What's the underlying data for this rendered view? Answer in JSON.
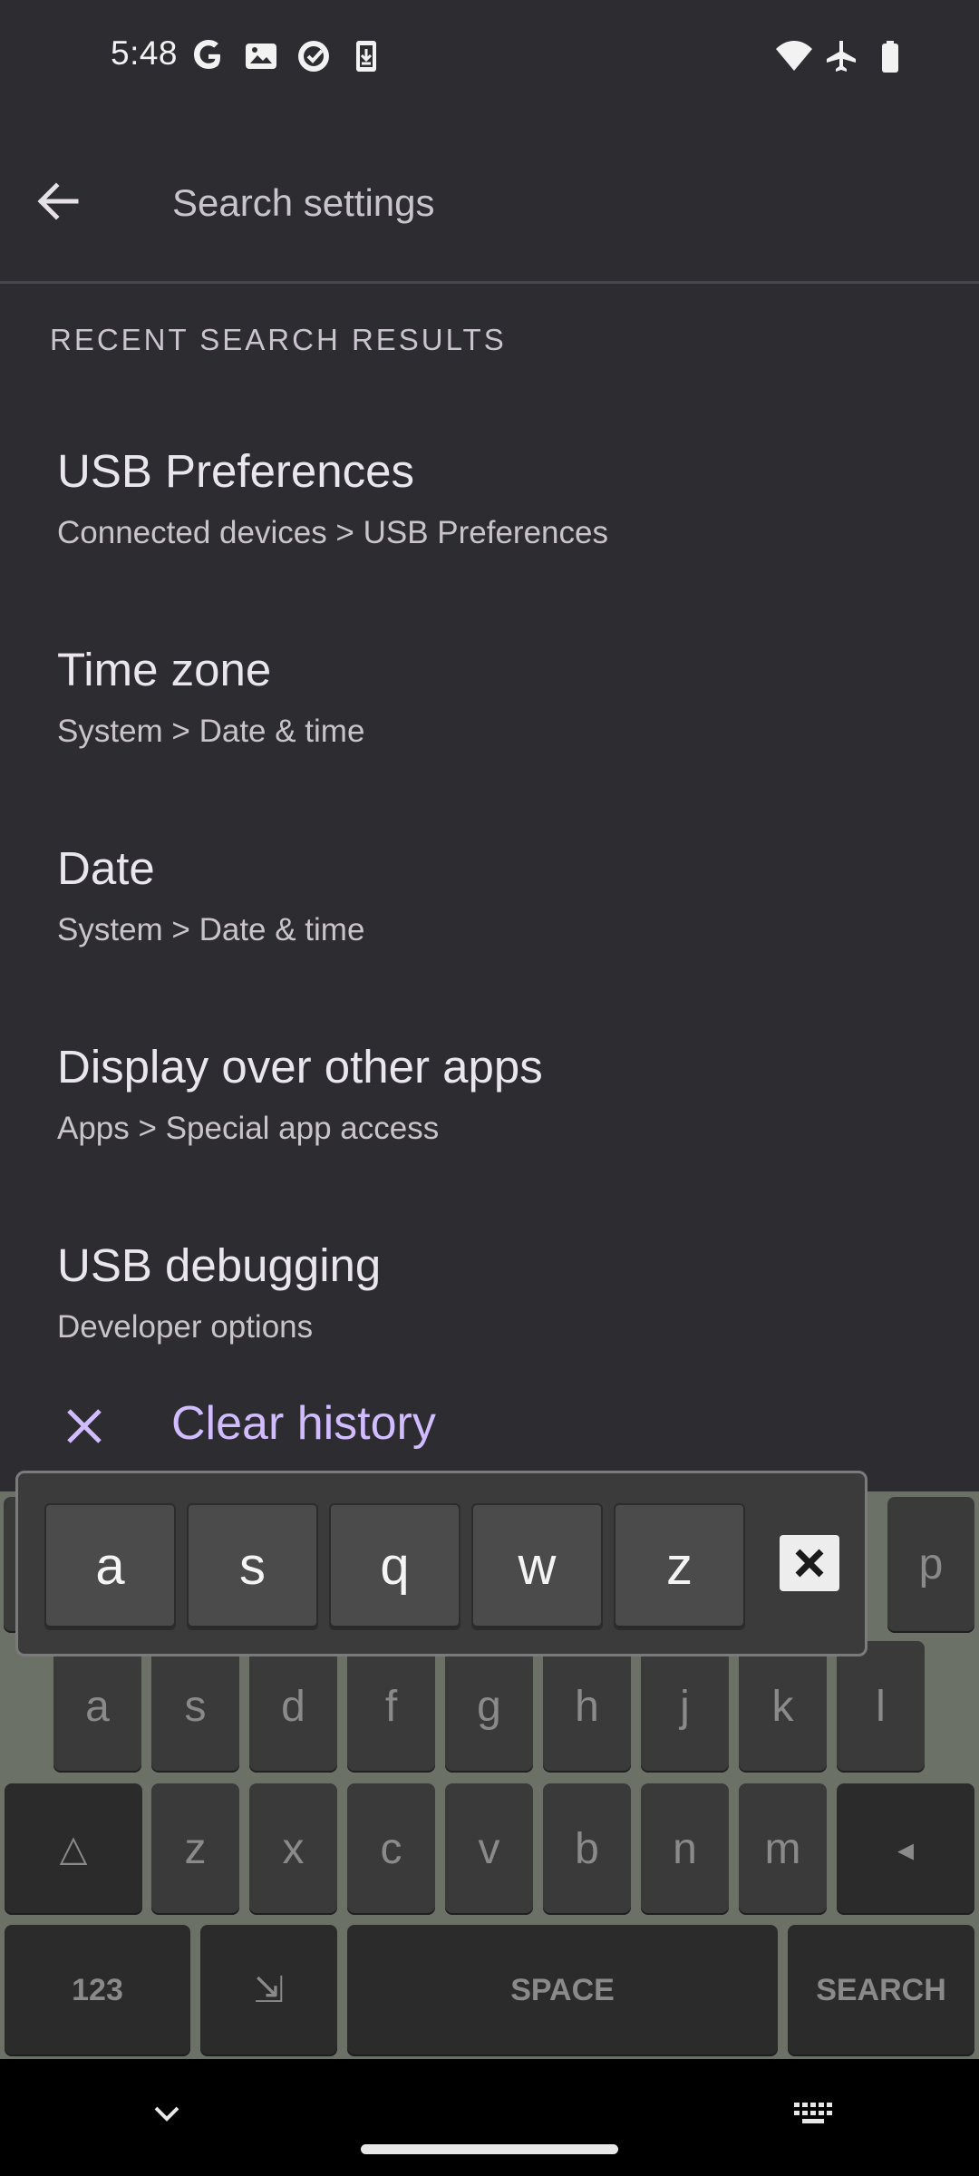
{
  "status_bar": {
    "time": "5:48",
    "left_icons": [
      "google-g-icon",
      "photos-icon",
      "tasks-check-icon",
      "download-icon"
    ],
    "right_icons": [
      "wifi-icon",
      "airplane-mode-icon",
      "battery-icon"
    ]
  },
  "search": {
    "placeholder": "Search settings",
    "value": ""
  },
  "section_header": "RECENT SEARCH RESULTS",
  "results": [
    {
      "title": "USB Preferences",
      "path": "Connected devices > USB Preferences"
    },
    {
      "title": "Time zone",
      "path": "System > Date & time"
    },
    {
      "title": "Date",
      "path": "System > Date & time"
    },
    {
      "title": "Display over other apps",
      "path": "Apps > Special app access"
    },
    {
      "title": "USB debugging",
      "path": "Developer options"
    }
  ],
  "clear_history": "Clear history",
  "suggestions": [
    "a",
    "s",
    "q",
    "w",
    "z"
  ],
  "keyboard": {
    "row_top_visible": [
      "p"
    ],
    "row2": [
      "a",
      "s",
      "d",
      "f",
      "g",
      "h",
      "j",
      "k",
      "l"
    ],
    "row3_letters": [
      "z",
      "x",
      "c",
      "v",
      "b",
      "n",
      "m"
    ],
    "shift_glyph": "△",
    "backspace_glyph": "◂",
    "numbers_key": "123",
    "dismiss_glyph": "⇲",
    "space_key": "SPACE",
    "action_key": "SEARCH"
  },
  "colors": {
    "background": "#2d2c31",
    "accent": "#d0bcff"
  }
}
